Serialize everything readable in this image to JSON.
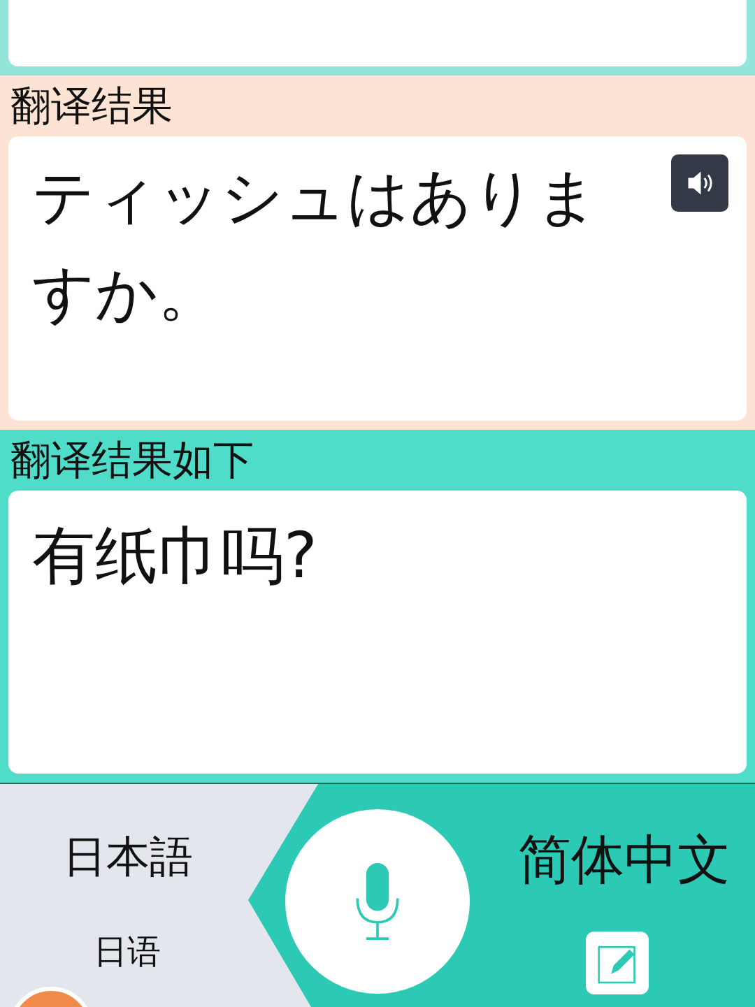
{
  "sections": [
    {
      "kind": "result",
      "label": "翻译结果",
      "text": "ティッシュはありますか。",
      "speaker": true
    },
    {
      "kind": "translation",
      "label": "翻译结果如下",
      "text": "有纸巾吗?",
      "speaker": false
    }
  ],
  "bottom_bar": {
    "source_language": {
      "name": "日本語",
      "subtitle": "日语"
    },
    "target_language": {
      "name": "简体中文"
    }
  }
}
